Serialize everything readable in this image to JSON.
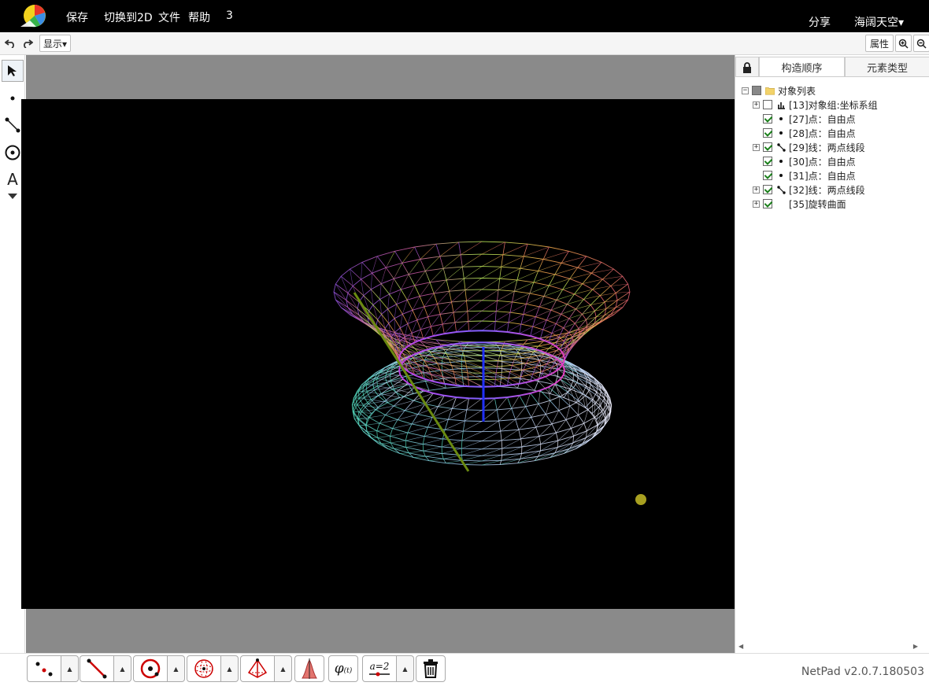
{
  "topbar": {
    "menu": [
      "保存",
      "切换到2D",
      "文件",
      "帮助",
      "3"
    ],
    "share": "分享",
    "user": "海阔天空▾"
  },
  "toolbar": {
    "undo_icon": "undo-icon",
    "redo_icon": "redo-icon",
    "display_label": "显示▾",
    "properties_label": "属性",
    "zoom_in_icon": "zoom-in-icon",
    "zoom_out_icon": "zoom-out-icon"
  },
  "left_tools": {
    "text_tool_label": "A"
  },
  "right_panel": {
    "tabs": [
      "构造顺序",
      "元素类型"
    ],
    "tree": {
      "root": "对象列表",
      "items": [
        {
          "label": "[13]对象组:坐标系组",
          "checked": false,
          "expandable": true,
          "icon": "chart-icon"
        },
        {
          "label": "[27]点：自由点",
          "checked": true,
          "expandable": false,
          "icon": "point-icon"
        },
        {
          "label": "[28]点：自由点",
          "checked": true,
          "expandable": false,
          "icon": "point-icon"
        },
        {
          "label": "[29]线：两点线段",
          "checked": true,
          "expandable": true,
          "icon": "segment-icon"
        },
        {
          "label": "[30]点：自由点",
          "checked": true,
          "expandable": false,
          "icon": "point-icon"
        },
        {
          "label": "[31]点：自由点",
          "checked": true,
          "expandable": false,
          "icon": "point-icon"
        },
        {
          "label": "[32]线：两点线段",
          "checked": true,
          "expandable": true,
          "icon": "segment-icon"
        },
        {
          "label": "[35]旋转曲面",
          "checked": true,
          "expandable": true,
          "icon": ""
        }
      ]
    }
  },
  "bottombar": {
    "formula_label": "a=2",
    "version": "NetPad v2.0.7.180503"
  }
}
